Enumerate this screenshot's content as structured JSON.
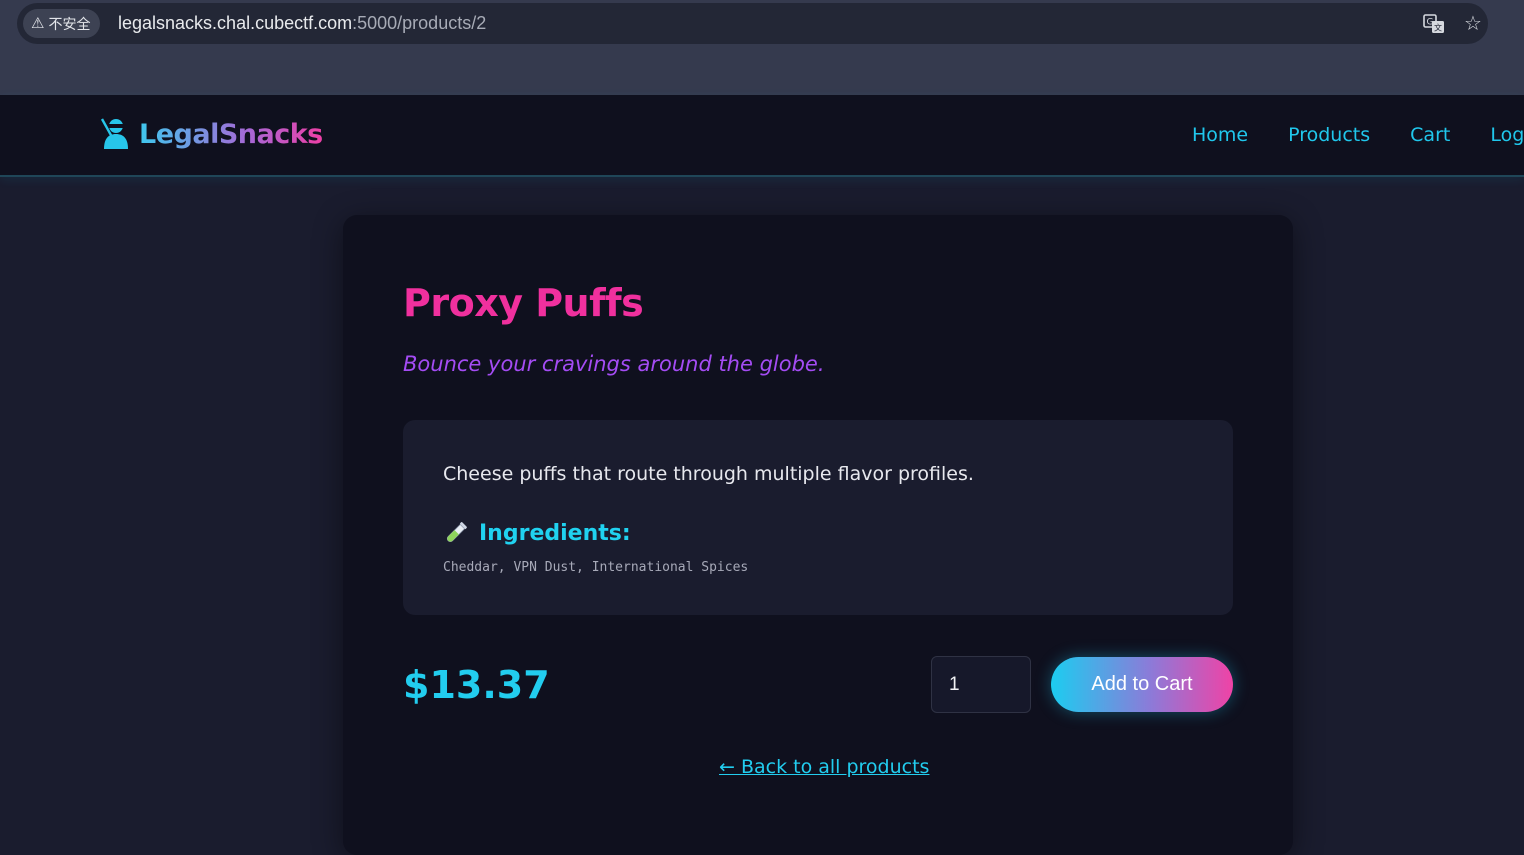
{
  "browser": {
    "security_label": "不安全",
    "url_host": "legalsnacks.chal.cubectf.com",
    "url_path": ":5000/products/2",
    "icons": [
      "warning-icon",
      "translate-icon",
      "star-icon",
      "extension-icon"
    ]
  },
  "navbar": {
    "brand_name": "LegalSnacks",
    "brand_icon": "ninja-icon",
    "links": [
      "Home",
      "Products",
      "Cart",
      "Logo"
    ]
  },
  "product": {
    "title": "Proxy Puffs",
    "tagline": "Bounce your cravings around the globe.",
    "description": "Cheese puffs that route through multiple flavor profiles.",
    "ingredients_heading": "Ingredients:",
    "ingredients_icon": "test-tube-icon",
    "ingredients": "Cheddar, VPN Dust, International Spices",
    "price": "$13.37",
    "quantity": "1",
    "add_to_cart_label": "Add to Cart",
    "back_link": "← Back to all products"
  },
  "colors": {
    "page_bg": "#1a1c2e",
    "card_bg": "#0f101e",
    "title": "#f0309e",
    "tagline": "#a44cf4",
    "accent_cyan": "#20c7ec"
  }
}
